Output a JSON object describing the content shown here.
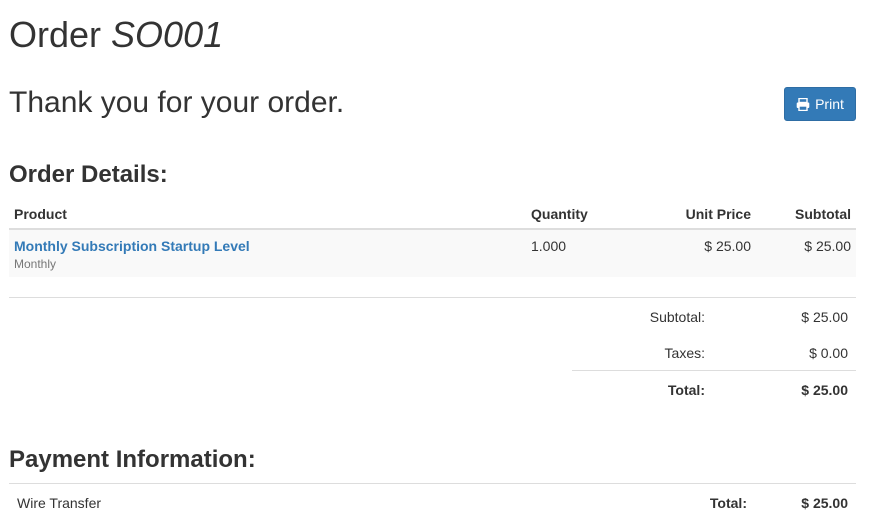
{
  "page": {
    "title_prefix": "Order",
    "order_number": "SO001",
    "thanks": "Thank you for your order."
  },
  "print_button": {
    "label": "Print",
    "icon": "print-icon"
  },
  "order_details": {
    "heading": "Order Details:",
    "columns": [
      "Product",
      "Quantity",
      "Unit Price",
      "Subtotal"
    ],
    "lines": [
      {
        "product": "Monthly Subscription Startup Level",
        "description": "Monthly",
        "quantity": "1.000",
        "unit_price": "$ 25.00",
        "subtotal": "$ 25.00"
      }
    ]
  },
  "totals": {
    "subtotal_label": "Subtotal:",
    "subtotal_value": "$ 25.00",
    "taxes_label": "Taxes:",
    "taxes_value": "$ 0.00",
    "total_label": "Total:",
    "total_value": "$ 25.00"
  },
  "payment": {
    "heading": "Payment Information:",
    "method": "Wire Transfer",
    "total_label": "Total:",
    "total_value": "$ 25.00"
  },
  "colors": {
    "accent": "#337ab7",
    "text": "#333333",
    "muted": "#777777",
    "border": "#dddddd"
  }
}
